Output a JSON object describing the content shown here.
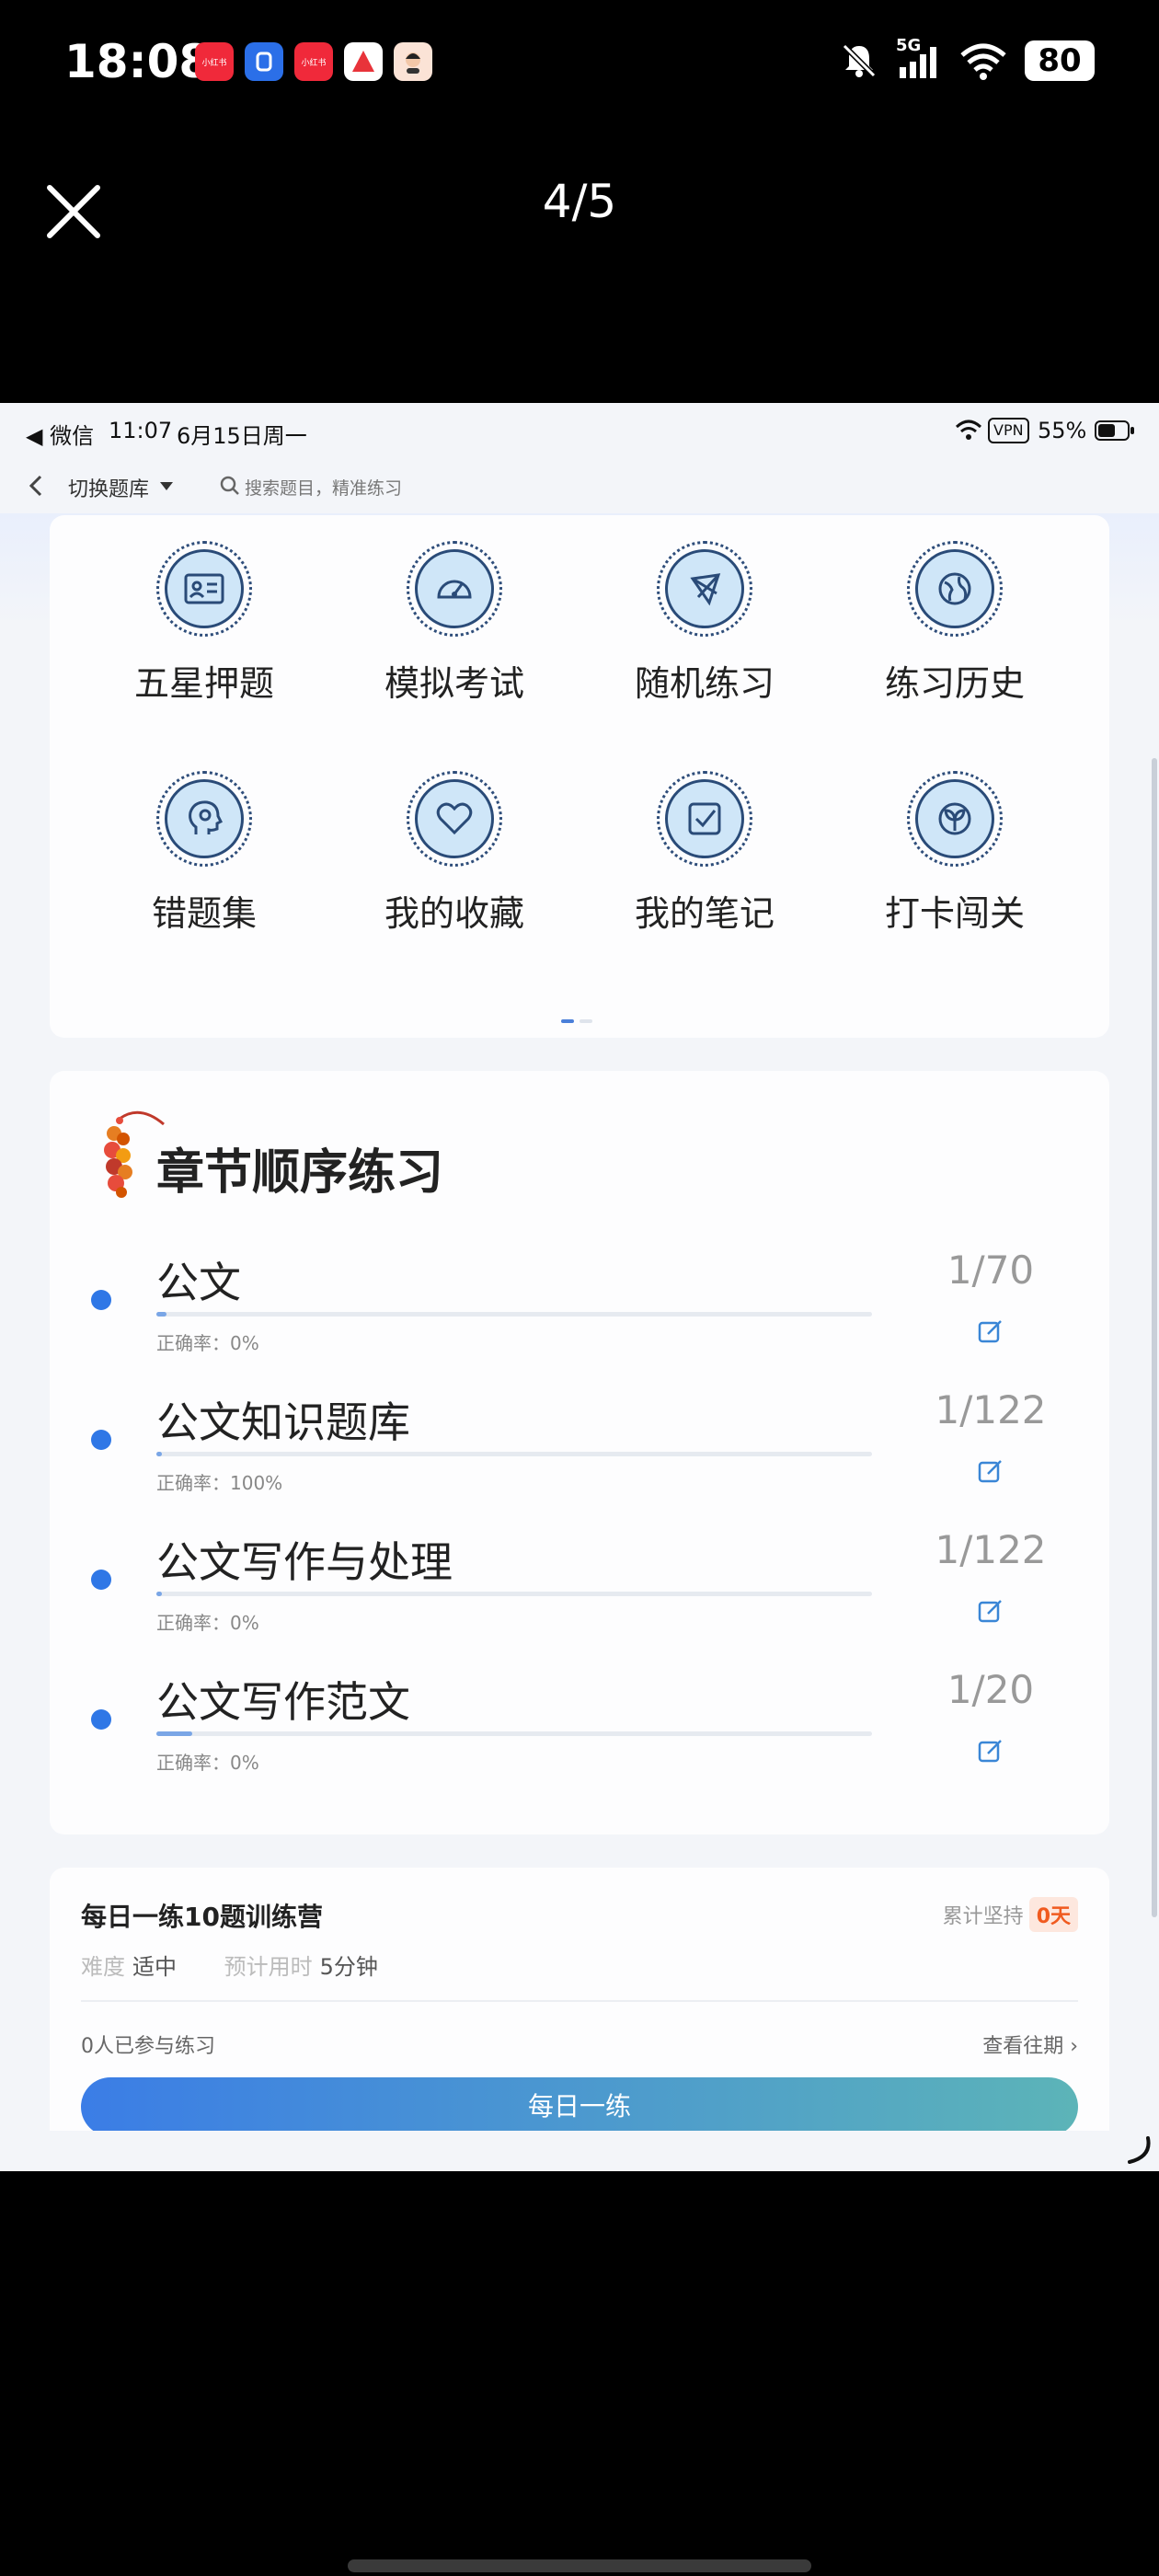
{
  "os_status": {
    "time": "18:08",
    "apps": [
      "小红书",
      "小红书",
      "小红书",
      "",
      ""
    ],
    "network": "5G",
    "battery": "80"
  },
  "viewer": {
    "counter": "4/5"
  },
  "inner_status": {
    "back_app": "◀ 微信",
    "time": "11:07",
    "date": "6月15日周一",
    "vpn": "VPN",
    "battery": "55%"
  },
  "inner_nav": {
    "switch_label": "切换题库",
    "search_placeholder": "搜索题目，精准练习"
  },
  "grid": {
    "items": [
      {
        "label": "五星押题",
        "icon": "id-card-icon"
      },
      {
        "label": "模拟考试",
        "icon": "speedometer-icon"
      },
      {
        "label": "随机练习",
        "icon": "random-shape-icon"
      },
      {
        "label": "练习历史",
        "icon": "globe-icon"
      },
      {
        "label": "错题集",
        "icon": "head-profile-icon"
      },
      {
        "label": "我的收藏",
        "icon": "heart-icon"
      },
      {
        "label": "我的笔记",
        "icon": "note-check-icon"
      },
      {
        "label": "打卡闯关",
        "icon": "plant-icon"
      }
    ]
  },
  "chapter": {
    "title": "章节顺序练习",
    "rows": [
      {
        "name": "公文",
        "count": "1/70",
        "rate": "正确率：0%",
        "progress": 0.014
      },
      {
        "name": "公文知识题库",
        "count": "1/122",
        "rate": "正确率：100%",
        "progress": 0.008
      },
      {
        "name": "公文写作与处理",
        "count": "1/122",
        "rate": "正确率：0%",
        "progress": 0.008
      },
      {
        "name": "公文写作范文",
        "count": "1/20",
        "rate": "正确率：0%",
        "progress": 0.05
      }
    ]
  },
  "daily": {
    "title": "每日一练10题训练营",
    "streak_label": "累计坚持",
    "streak_value": "0天",
    "difficulty_label": "难度",
    "difficulty_value": "适中",
    "time_label": "预计用时",
    "time_value": "5分钟",
    "participants": "0人已参与练习",
    "history_link": "查看往期 ›",
    "button": "每日一练"
  }
}
